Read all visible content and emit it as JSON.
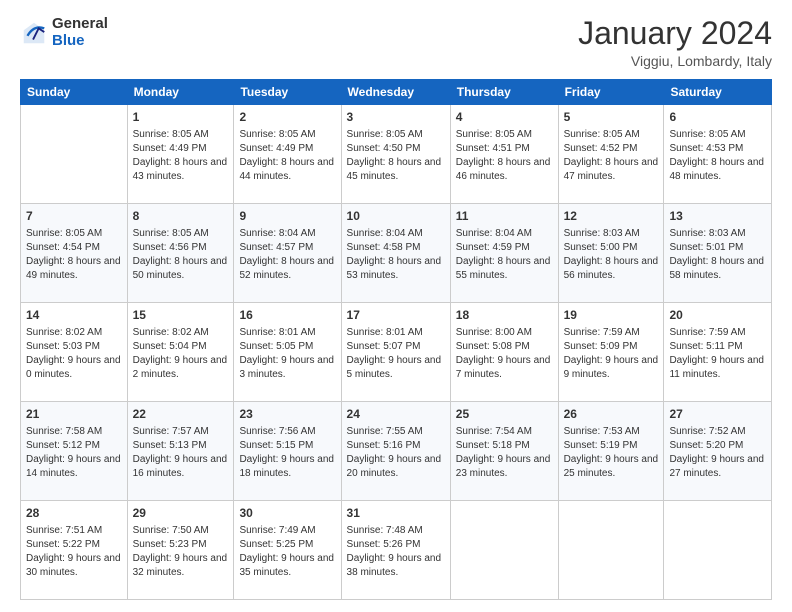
{
  "logo": {
    "general": "General",
    "blue": "Blue"
  },
  "header": {
    "month": "January 2024",
    "location": "Viggiu, Lombardy, Italy"
  },
  "days": [
    "Sunday",
    "Monday",
    "Tuesday",
    "Wednesday",
    "Thursday",
    "Friday",
    "Saturday"
  ],
  "weeks": [
    [
      {
        "day": "",
        "sunrise": "",
        "sunset": "",
        "daylight": ""
      },
      {
        "day": "1",
        "sunrise": "Sunrise: 8:05 AM",
        "sunset": "Sunset: 4:49 PM",
        "daylight": "Daylight: 8 hours and 43 minutes."
      },
      {
        "day": "2",
        "sunrise": "Sunrise: 8:05 AM",
        "sunset": "Sunset: 4:49 PM",
        "daylight": "Daylight: 8 hours and 44 minutes."
      },
      {
        "day": "3",
        "sunrise": "Sunrise: 8:05 AM",
        "sunset": "Sunset: 4:50 PM",
        "daylight": "Daylight: 8 hours and 45 minutes."
      },
      {
        "day": "4",
        "sunrise": "Sunrise: 8:05 AM",
        "sunset": "Sunset: 4:51 PM",
        "daylight": "Daylight: 8 hours and 46 minutes."
      },
      {
        "day": "5",
        "sunrise": "Sunrise: 8:05 AM",
        "sunset": "Sunset: 4:52 PM",
        "daylight": "Daylight: 8 hours and 47 minutes."
      },
      {
        "day": "6",
        "sunrise": "Sunrise: 8:05 AM",
        "sunset": "Sunset: 4:53 PM",
        "daylight": "Daylight: 8 hours and 48 minutes."
      }
    ],
    [
      {
        "day": "7",
        "sunrise": "Sunrise: 8:05 AM",
        "sunset": "Sunset: 4:54 PM",
        "daylight": "Daylight: 8 hours and 49 minutes."
      },
      {
        "day": "8",
        "sunrise": "Sunrise: 8:05 AM",
        "sunset": "Sunset: 4:56 PM",
        "daylight": "Daylight: 8 hours and 50 minutes."
      },
      {
        "day": "9",
        "sunrise": "Sunrise: 8:04 AM",
        "sunset": "Sunset: 4:57 PM",
        "daylight": "Daylight: 8 hours and 52 minutes."
      },
      {
        "day": "10",
        "sunrise": "Sunrise: 8:04 AM",
        "sunset": "Sunset: 4:58 PM",
        "daylight": "Daylight: 8 hours and 53 minutes."
      },
      {
        "day": "11",
        "sunrise": "Sunrise: 8:04 AM",
        "sunset": "Sunset: 4:59 PM",
        "daylight": "Daylight: 8 hours and 55 minutes."
      },
      {
        "day": "12",
        "sunrise": "Sunrise: 8:03 AM",
        "sunset": "Sunset: 5:00 PM",
        "daylight": "Daylight: 8 hours and 56 minutes."
      },
      {
        "day": "13",
        "sunrise": "Sunrise: 8:03 AM",
        "sunset": "Sunset: 5:01 PM",
        "daylight": "Daylight: 8 hours and 58 minutes."
      }
    ],
    [
      {
        "day": "14",
        "sunrise": "Sunrise: 8:02 AM",
        "sunset": "Sunset: 5:03 PM",
        "daylight": "Daylight: 9 hours and 0 minutes."
      },
      {
        "day": "15",
        "sunrise": "Sunrise: 8:02 AM",
        "sunset": "Sunset: 5:04 PM",
        "daylight": "Daylight: 9 hours and 2 minutes."
      },
      {
        "day": "16",
        "sunrise": "Sunrise: 8:01 AM",
        "sunset": "Sunset: 5:05 PM",
        "daylight": "Daylight: 9 hours and 3 minutes."
      },
      {
        "day": "17",
        "sunrise": "Sunrise: 8:01 AM",
        "sunset": "Sunset: 5:07 PM",
        "daylight": "Daylight: 9 hours and 5 minutes."
      },
      {
        "day": "18",
        "sunrise": "Sunrise: 8:00 AM",
        "sunset": "Sunset: 5:08 PM",
        "daylight": "Daylight: 9 hours and 7 minutes."
      },
      {
        "day": "19",
        "sunrise": "Sunrise: 7:59 AM",
        "sunset": "Sunset: 5:09 PM",
        "daylight": "Daylight: 9 hours and 9 minutes."
      },
      {
        "day": "20",
        "sunrise": "Sunrise: 7:59 AM",
        "sunset": "Sunset: 5:11 PM",
        "daylight": "Daylight: 9 hours and 11 minutes."
      }
    ],
    [
      {
        "day": "21",
        "sunrise": "Sunrise: 7:58 AM",
        "sunset": "Sunset: 5:12 PM",
        "daylight": "Daylight: 9 hours and 14 minutes."
      },
      {
        "day": "22",
        "sunrise": "Sunrise: 7:57 AM",
        "sunset": "Sunset: 5:13 PM",
        "daylight": "Daylight: 9 hours and 16 minutes."
      },
      {
        "day": "23",
        "sunrise": "Sunrise: 7:56 AM",
        "sunset": "Sunset: 5:15 PM",
        "daylight": "Daylight: 9 hours and 18 minutes."
      },
      {
        "day": "24",
        "sunrise": "Sunrise: 7:55 AM",
        "sunset": "Sunset: 5:16 PM",
        "daylight": "Daylight: 9 hours and 20 minutes."
      },
      {
        "day": "25",
        "sunrise": "Sunrise: 7:54 AM",
        "sunset": "Sunset: 5:18 PM",
        "daylight": "Daylight: 9 hours and 23 minutes."
      },
      {
        "day": "26",
        "sunrise": "Sunrise: 7:53 AM",
        "sunset": "Sunset: 5:19 PM",
        "daylight": "Daylight: 9 hours and 25 minutes."
      },
      {
        "day": "27",
        "sunrise": "Sunrise: 7:52 AM",
        "sunset": "Sunset: 5:20 PM",
        "daylight": "Daylight: 9 hours and 27 minutes."
      }
    ],
    [
      {
        "day": "28",
        "sunrise": "Sunrise: 7:51 AM",
        "sunset": "Sunset: 5:22 PM",
        "daylight": "Daylight: 9 hours and 30 minutes."
      },
      {
        "day": "29",
        "sunrise": "Sunrise: 7:50 AM",
        "sunset": "Sunset: 5:23 PM",
        "daylight": "Daylight: 9 hours and 32 minutes."
      },
      {
        "day": "30",
        "sunrise": "Sunrise: 7:49 AM",
        "sunset": "Sunset: 5:25 PM",
        "daylight": "Daylight: 9 hours and 35 minutes."
      },
      {
        "day": "31",
        "sunrise": "Sunrise: 7:48 AM",
        "sunset": "Sunset: 5:26 PM",
        "daylight": "Daylight: 9 hours and 38 minutes."
      },
      {
        "day": "",
        "sunrise": "",
        "sunset": "",
        "daylight": ""
      },
      {
        "day": "",
        "sunrise": "",
        "sunset": "",
        "daylight": ""
      },
      {
        "day": "",
        "sunrise": "",
        "sunset": "",
        "daylight": ""
      }
    ]
  ]
}
